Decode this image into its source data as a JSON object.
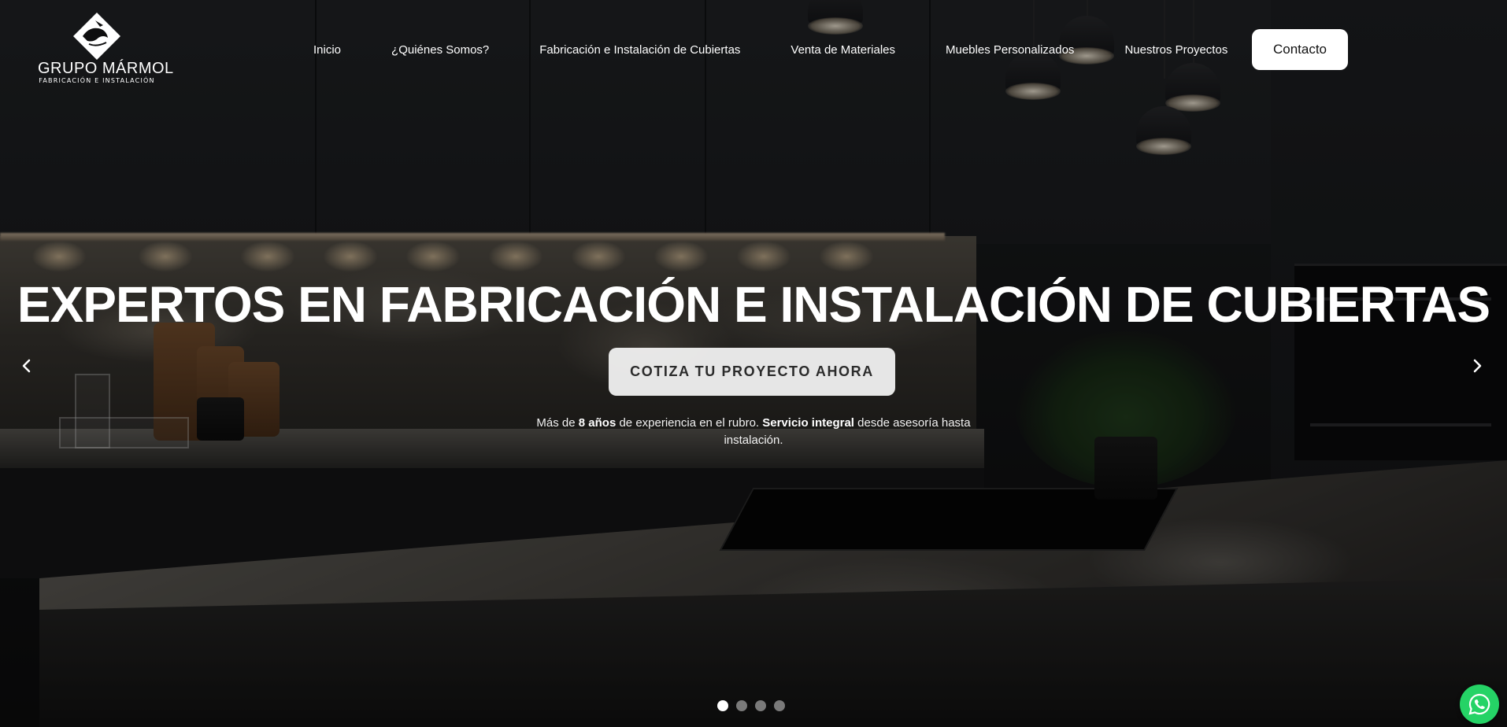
{
  "brand": {
    "name": "GRUPO MÁRMOL",
    "tagline": "FABRICACIÓN E INSTALACIÓN",
    "logo_icon": "marble-block-logo-icon"
  },
  "nav": {
    "items": [
      {
        "label": "Inicio"
      },
      {
        "label": "¿Quiénes Somos?"
      },
      {
        "label": "Fabricación e Instalación de Cubiertas"
      },
      {
        "label": "Venta de Materiales"
      },
      {
        "label": "Muebles Personalizados"
      },
      {
        "label": "Nuestros Proyectos"
      }
    ],
    "contact_label": "Contacto"
  },
  "hero": {
    "headline": "EXPERTOS EN FABRICACIÓN E INSTALACIÓN DE CUBIERTAS",
    "cta_label": "COTIZA TU PROYECTO AHORA",
    "desc_1": "Más de ",
    "desc_2": "8 años",
    "desc_3": " de experiencia en el rubro. ",
    "desc_4": "Servicio integral",
    "desc_5": " desde asesoría hasta instalación."
  },
  "carousel": {
    "prev_icon": "chevron-left-icon",
    "next_icon": "chevron-right-icon",
    "slide_count": 4,
    "active_slide": 1
  },
  "whatsapp": {
    "icon": "whatsapp-icon",
    "color": "#25d366"
  },
  "colors": {
    "contact_bg": "#ffffff",
    "cta_bg": "#f5f5f5",
    "text": "#ffffff"
  }
}
